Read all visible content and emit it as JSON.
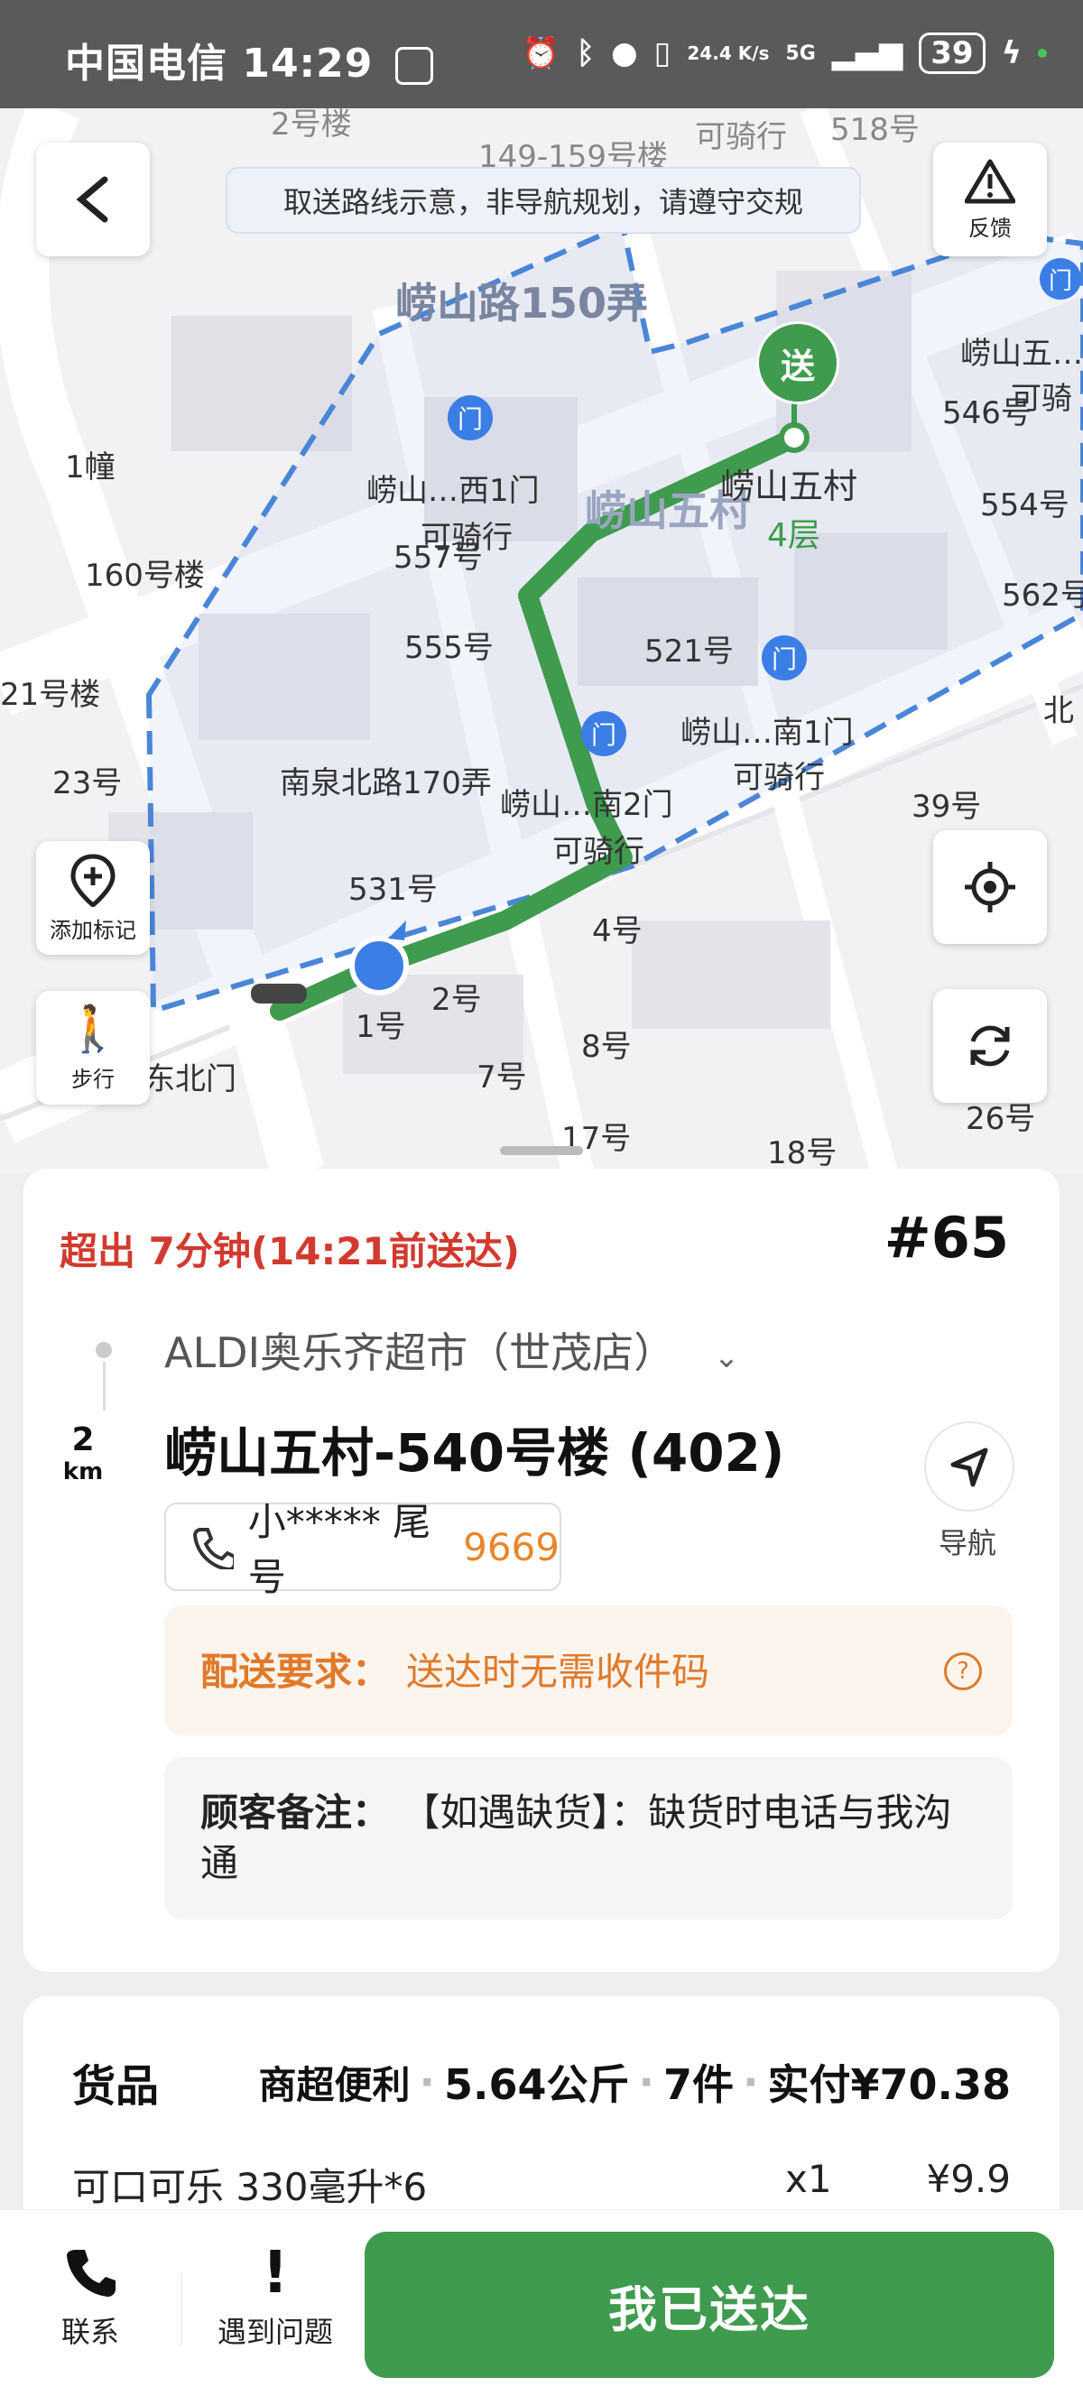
{
  "status_bar": {
    "carrier": "中国电信",
    "time": "14:29",
    "speed": "24.4 K/s",
    "network": "5G",
    "battery": "39"
  },
  "map": {
    "notice": "取送路线示意，非导航规划，请遵守交规",
    "feedback_label": "反馈",
    "add_marker_label": "添加标记",
    "walk_label": "步行",
    "deliver_pin": "送",
    "gate_pin": "门",
    "labels": {
      "road_150": "崂山路150弄",
      "laoshan_wucun_area": "崂山五村",
      "building_149": "149-159号楼",
      "kqx_top": "可骑行",
      "n518": "518号",
      "n2_top": "2号楼",
      "n1_building": "1幢",
      "n160": "160号楼",
      "n21": "21号楼",
      "n23": "23号",
      "n555": "555号",
      "n521": "521号",
      "n531": "531号",
      "n4": "4号",
      "n1": "1号",
      "n2": "2号",
      "n7": "7号",
      "n8": "8号",
      "n17": "17号",
      "n18": "18号",
      "n39": "39号",
      "n546": "546号",
      "n554": "554号",
      "n562": "562号",
      "n26": "26号",
      "n557": "557号",
      "nanquan": "南泉北路170弄",
      "gate_west": "崂山…西1门",
      "gate_west_sub": "可骑行",
      "gate_south2": "崂山…南2门",
      "gate_south2_sub": "可骑行",
      "gate_south1": "崂山…南1门",
      "gate_south1_sub": "可骑行",
      "gate_east": "崂山五…",
      "gate_east_sub": "可骑",
      "dest_name": "崂山五村",
      "dest_floor": "4层",
      "northeast_gate": "东北门",
      "north": "北"
    }
  },
  "order": {
    "overdue_text": "超出 7分钟(14:21前送达)",
    "order_number": "#65",
    "store_name": "ALDI奥乐齐超市（世茂店）",
    "distance_value": "2",
    "distance_unit": "km",
    "address": "崂山五村-540号楼 (402)",
    "phone_masked": "小***** 尾号",
    "phone_tail": "9669",
    "nav_label": "导航",
    "requirement_label": "配送要求：",
    "requirement_text": "送达时无需收件码",
    "note_label": "顾客备注：",
    "note_text": "【如遇缺货】：缺货时电话与我沟通"
  },
  "goods": {
    "title": "货品",
    "category": "商超便利",
    "weight": "5.64公斤",
    "count": "7件",
    "paid": "实付¥70.38",
    "items": [
      {
        "name": "可口可乐 330毫升*6",
        "qty": "x1",
        "price": "¥9.9"
      }
    ]
  },
  "bottom": {
    "contact_label": "联系",
    "problem_label": "遇到问题",
    "delivered_label": "我已送达"
  },
  "colors": {
    "route_green": "#3f9b4d",
    "overdue_red": "#d23a2f",
    "phone_orange": "#e8862a",
    "gate_blue": "#3a7ee6"
  }
}
